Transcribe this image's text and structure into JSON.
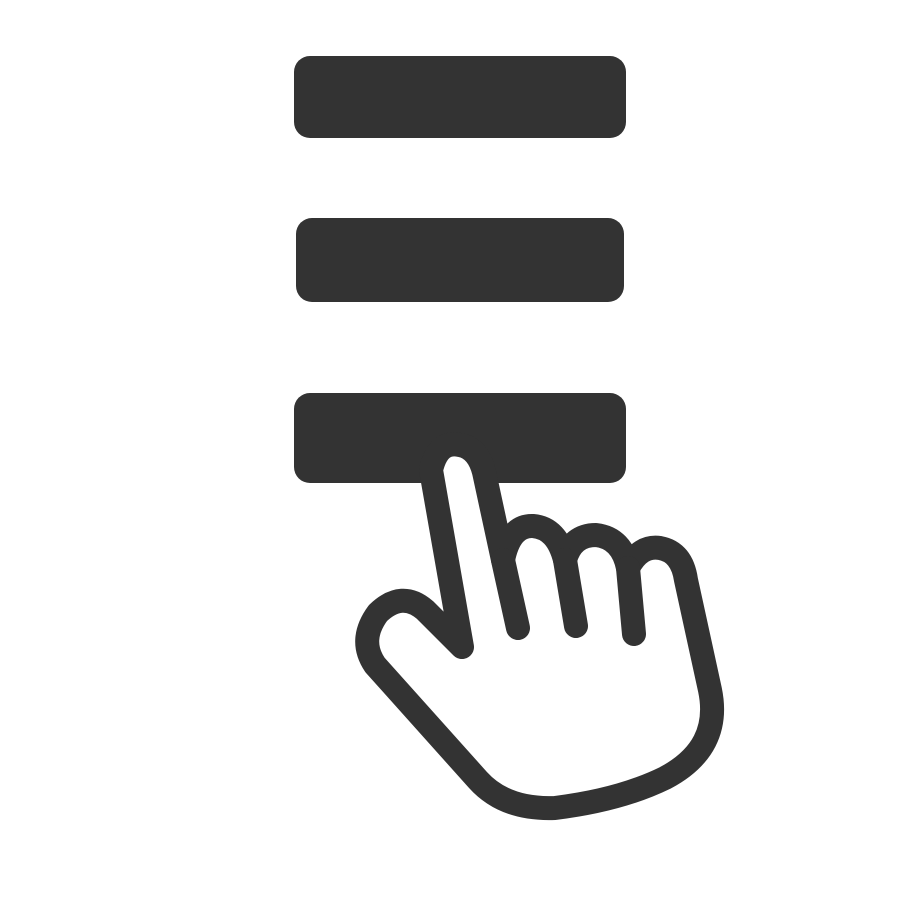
{
  "icon": {
    "name": "menu-tap-icon",
    "parts": [
      "hamburger-menu-icon",
      "pointing-hand-icon"
    ],
    "color": "#333333",
    "background": "#ffffff"
  }
}
